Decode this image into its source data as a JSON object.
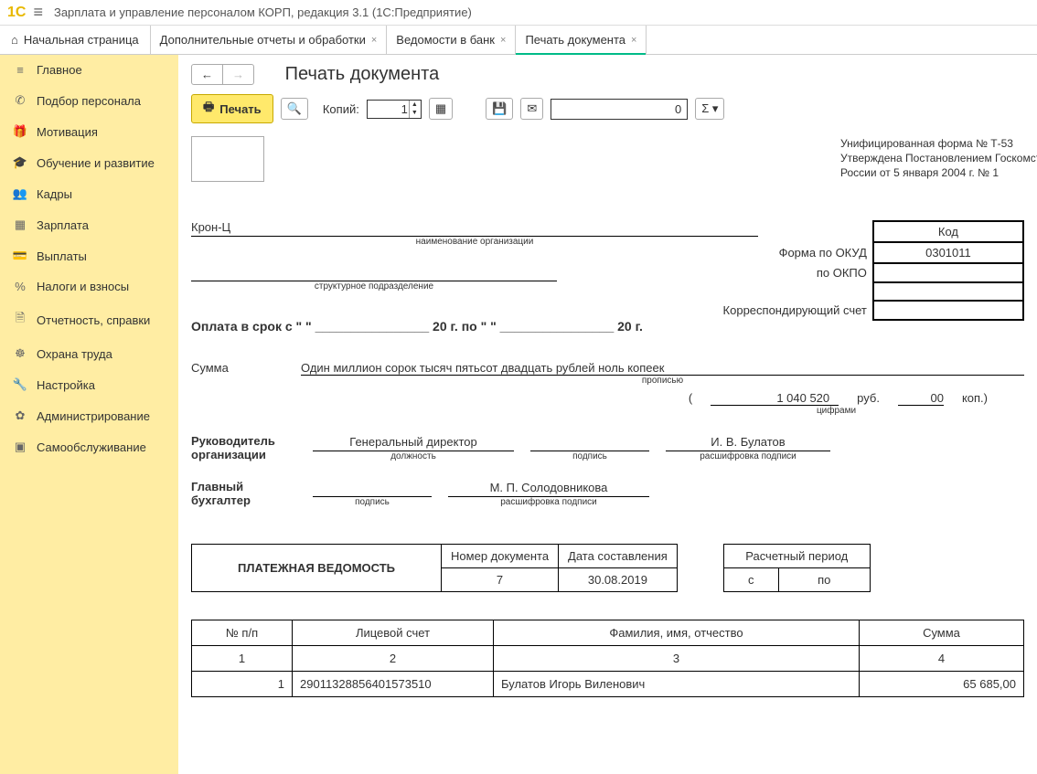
{
  "app": {
    "title": "Зарплата и управление персоналом КОРП, редакция 3.1  (1С:Предприятие)"
  },
  "tabs": {
    "home": "Начальная страница",
    "items": [
      {
        "label": "Дополнительные отчеты и обработки"
      },
      {
        "label": "Ведомости в банк"
      },
      {
        "label": "Печать документа"
      }
    ]
  },
  "sidebar": {
    "items": [
      {
        "label": "Главное"
      },
      {
        "label": "Подбор персонала"
      },
      {
        "label": "Мотивация"
      },
      {
        "label": "Обучение и развитие"
      },
      {
        "label": "Кадры"
      },
      {
        "label": "Зарплата"
      },
      {
        "label": "Выплаты"
      },
      {
        "label": "Налоги и взносы"
      },
      {
        "label": "Отчетность, справки"
      },
      {
        "label": "Охрана труда"
      },
      {
        "label": "Настройка"
      },
      {
        "label": "Администрирование"
      },
      {
        "label": "Самообслуживание"
      }
    ]
  },
  "page": {
    "heading": "Печать документа"
  },
  "toolbar": {
    "print": "Печать",
    "copies_label": "Копий:",
    "copies": "1",
    "zero": "0"
  },
  "doc": {
    "form_line1": "Унифицированная форма № Т-53",
    "form_line2": "Утверждена Постановлением Госкомстата",
    "form_line3": "России от 5 января 2004 г. № 1",
    "code_hdr": "Код",
    "code_val": "0301011",
    "okud": "Форма по ОКУД",
    "okpo": "по ОКПО",
    "org": "Крон-Ц",
    "org_sub": "наименование организации",
    "dept_sub": "структурное подразделение",
    "corr": "Корреспондирующий счет",
    "pay_text": "Оплата в срок с \"       \" ________________  20      г. по \"       \" ________________  20       г.",
    "sum_label": "Сумма",
    "sum_text": "Один миллион сорок тысяч пятьсот двадцать рублей ноль копеек",
    "sum_sub": "прописью",
    "amount": "1 040 520",
    "rub": "руб.",
    "kop_val": "00",
    "kop": "коп.)",
    "digits_sub": "цифрами",
    "mgr_label": "Руководитель организации",
    "mgr_job": "Генеральный директор",
    "mgr_name": "И. В. Булатов",
    "job_sub": "должность",
    "sign_sub": "подпись",
    "decode_sub": "расшифровка подписи",
    "acc_label": "Главный бухгалтер",
    "acc_name": "М. П. Солодовникова",
    "title": "ПЛАТЕЖНАЯ ВЕДОМОСТЬ",
    "num_hdr": "Номер документа",
    "date_hdr": "Дата составления",
    "doc_num": "7",
    "doc_date": "30.08.2019",
    "period_hdr": "Расчетный период",
    "from": "с",
    "to": "по",
    "th1": "№ п/п",
    "th2": "Лицевой счет",
    "th3": "Фамилия, имя, отчество",
    "th4": "Сумма",
    "rows": [
      {
        "n": "1",
        "acc": "29011328856401573510",
        "fio": "Булатов Игорь Виленович",
        "sum": "65 685,00"
      }
    ]
  }
}
